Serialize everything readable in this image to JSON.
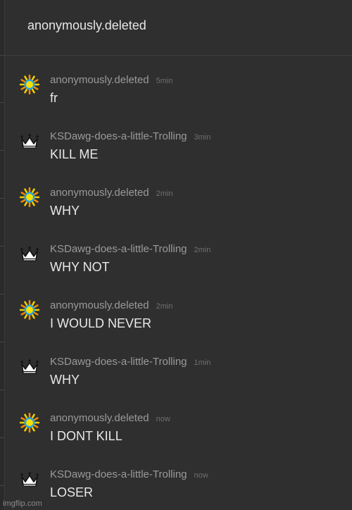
{
  "header": {
    "title": "anonymously.deleted"
  },
  "messages": [
    {
      "avatar": "sun-icon",
      "user": "anonymously.deleted",
      "time": "5min",
      "text": "fr"
    },
    {
      "avatar": "crown-icon",
      "user": "KSDawg-does-a-little-Trolling",
      "time": "3min",
      "text": "KILL ME"
    },
    {
      "avatar": "sun-icon",
      "user": "anonymously.deleted",
      "time": "2min",
      "text": "WHY"
    },
    {
      "avatar": "crown-icon",
      "user": "KSDawg-does-a-little-Trolling",
      "time": "2min",
      "text": "WHY NOT"
    },
    {
      "avatar": "sun-icon",
      "user": "anonymously.deleted",
      "time": "2min",
      "text": "I WOULD NEVER"
    },
    {
      "avatar": "crown-icon",
      "user": "KSDawg-does-a-little-Trolling",
      "time": "1min",
      "text": "WHY"
    },
    {
      "avatar": "sun-icon",
      "user": "anonymously.deleted",
      "time": "now",
      "text": "I DONT KILL"
    },
    {
      "avatar": "crown-icon",
      "user": "KSDawg-does-a-little-Trolling",
      "time": "now",
      "text": "LOSER"
    }
  ],
  "watermark": "imgflip.com",
  "colors": {
    "background": "#2f2f2f",
    "username": "#9a9a9a",
    "message_text": "#e8e8e8",
    "sun_ring": "#2aa3e0",
    "sun_center": "#f5e000"
  }
}
